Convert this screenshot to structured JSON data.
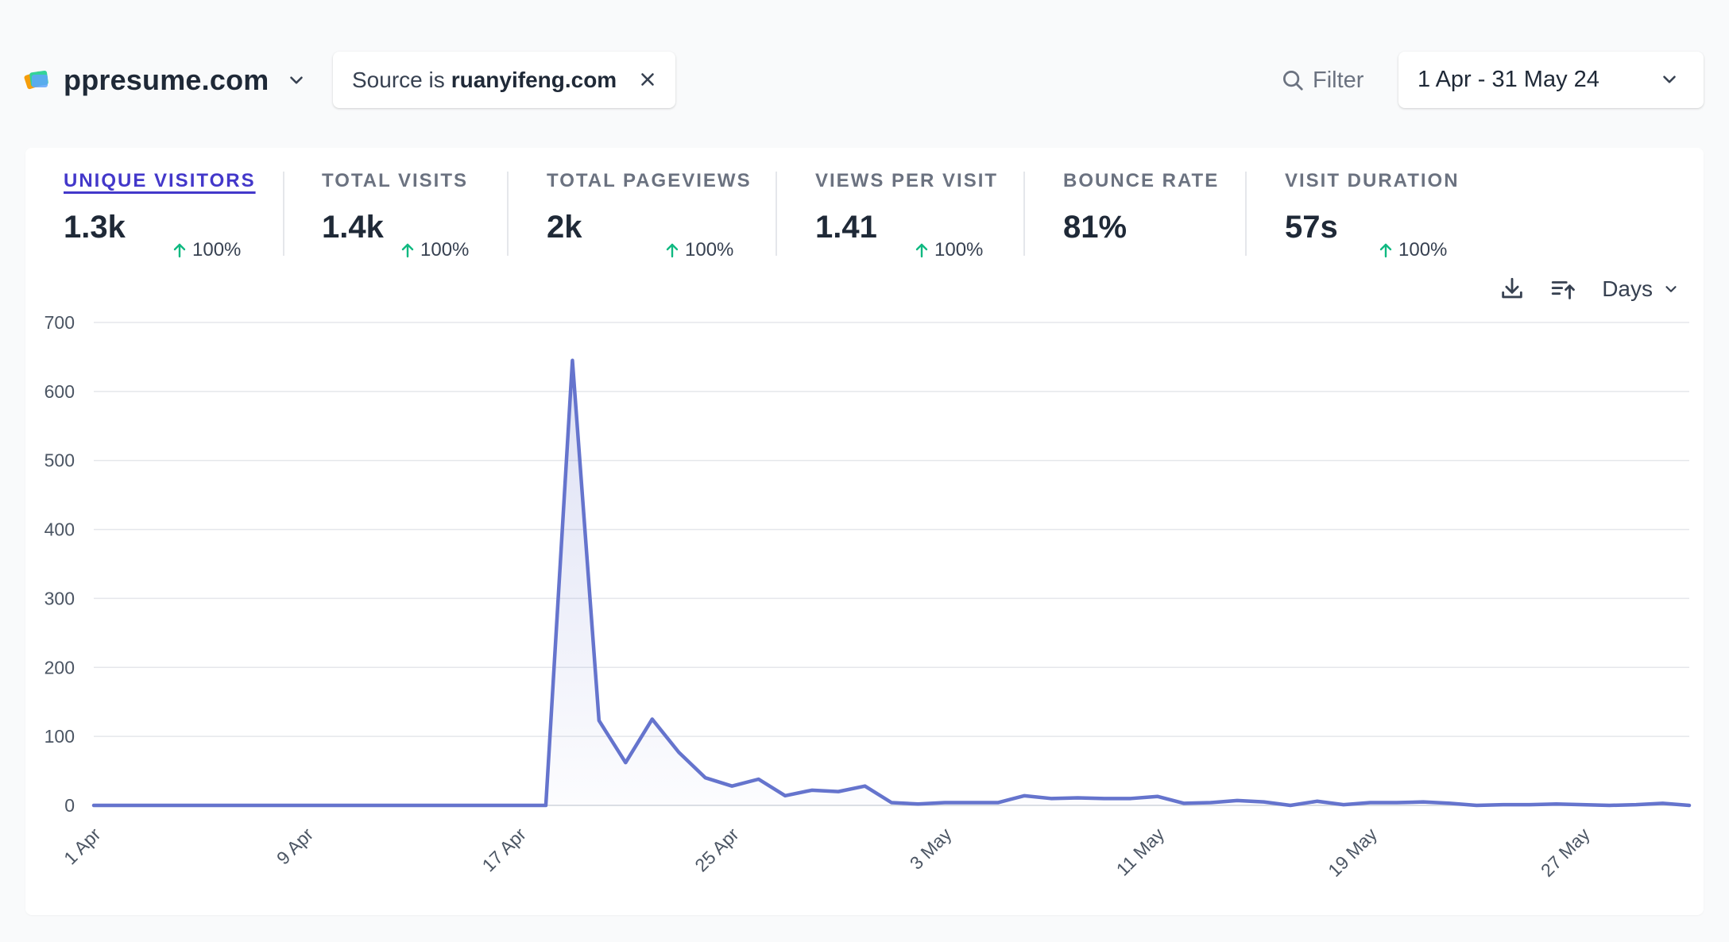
{
  "header": {
    "site_name": "ppresume.com",
    "filter": {
      "label": "Source is",
      "value": "ruanyifeng.com"
    },
    "filter_button": "Filter",
    "date_range": "1 Apr - 31 May 24"
  },
  "metrics": [
    {
      "label": "UNIQUE VISITORS",
      "value": "1.3k",
      "change": "100%",
      "active": true
    },
    {
      "label": "TOTAL VISITS",
      "value": "1.4k",
      "change": "100%"
    },
    {
      "label": "TOTAL PAGEVIEWS",
      "value": "2k",
      "change": "100%"
    },
    {
      "label": "VIEWS PER VISIT",
      "value": "1.41",
      "change": "100%"
    },
    {
      "label": "BOUNCE RATE",
      "value": "81%"
    },
    {
      "label": "VISIT DURATION",
      "value": "57s",
      "change": "100%"
    }
  ],
  "chart_controls": {
    "interval": "Days",
    "icons": [
      "download-icon",
      "sort-ascending-icon"
    ]
  },
  "colors": {
    "line": "#6574cd",
    "active_metric": "#4338ca",
    "change_up": "#10b981"
  },
  "chart_data": {
    "type": "line",
    "series": [
      {
        "values": [
          0,
          0,
          0,
          0,
          0,
          0,
          0,
          0,
          0,
          0,
          0,
          0,
          0,
          0,
          0,
          0,
          0,
          0,
          645,
          123,
          62,
          125,
          77,
          40,
          28,
          38,
          14,
          22,
          20,
          28,
          4,
          2,
          4,
          4,
          4,
          14,
          10,
          11,
          10,
          10,
          13,
          3,
          4,
          7,
          5,
          0,
          6,
          1,
          4,
          4,
          5,
          3,
          0,
          1,
          1,
          2,
          1,
          0,
          1,
          3,
          0
        ]
      }
    ],
    "x_start": "1 Apr",
    "x_end": "31 May",
    "x_ticks": [
      "1 Apr",
      "9 Apr",
      "17 Apr",
      "25 Apr",
      "3 May",
      "11 May",
      "19 May",
      "27 May"
    ],
    "y_ticks": [
      "0",
      "100",
      "200",
      "300",
      "400",
      "500",
      "600",
      "700"
    ],
    "ylim": [
      0,
      700
    ],
    "grid": true,
    "fill": "light gradient under line"
  }
}
